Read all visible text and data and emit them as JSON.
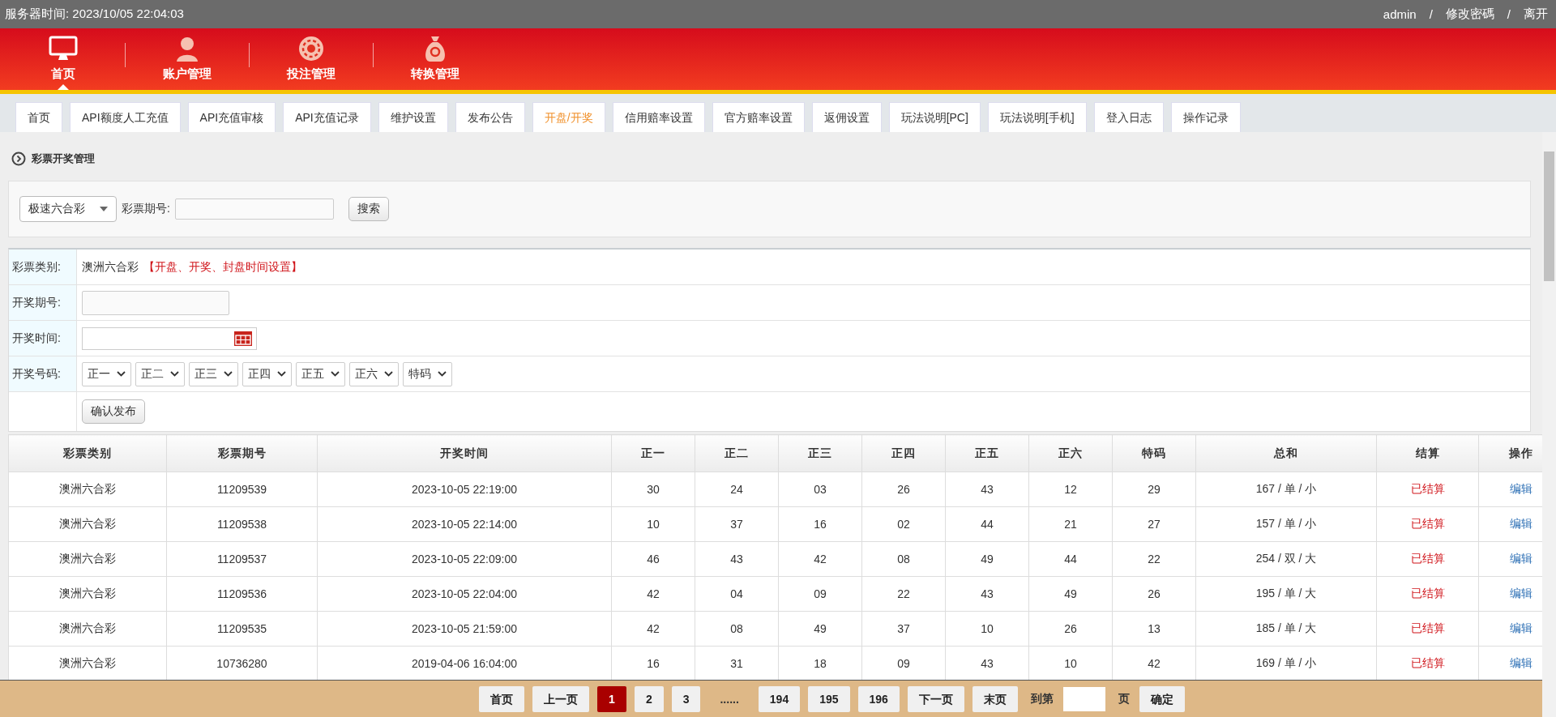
{
  "top_bar": {
    "server_time_label": "服务器时间:",
    "server_time": "2023/10/05 22:04:03",
    "user": "admin",
    "separator": "/",
    "links": [
      "修改密碼",
      "离开"
    ]
  },
  "main_nav": [
    {
      "label": "首页",
      "selected": true
    },
    {
      "label": "账户管理",
      "selected": false
    },
    {
      "label": "投注管理",
      "selected": false
    },
    {
      "label": "转换管理",
      "selected": false
    }
  ],
  "tabs": [
    {
      "label": "首页",
      "selected": false
    },
    {
      "label": "API额度人工充值",
      "selected": false
    },
    {
      "label": "API充值审核",
      "selected": false
    },
    {
      "label": "API充值记录",
      "selected": false
    },
    {
      "label": "维护设置",
      "selected": false
    },
    {
      "label": "发布公告",
      "selected": false
    },
    {
      "label": "开盘/开奖",
      "selected": true
    },
    {
      "label": "信用赔率设置",
      "selected": false
    },
    {
      "label": "官方赔率设置",
      "selected": false
    },
    {
      "label": "返佣设置",
      "selected": false
    },
    {
      "label": "玩法说明[PC]",
      "selected": false
    },
    {
      "label": "玩法说明[手机]",
      "selected": false
    },
    {
      "label": "登入日志",
      "selected": false
    },
    {
      "label": "操作记录",
      "selected": false
    }
  ],
  "section_title": "彩票开奖管理",
  "search": {
    "lottery_select": "极速六合彩",
    "period_label": "彩票期号:",
    "button": "搜索"
  },
  "form": [
    {
      "kind": "text",
      "label": "彩票类别:",
      "value": "澳洲六合彩",
      "link": "【开盘、开奖、封盘时间设置】"
    },
    {
      "kind": "input",
      "label": "开奖期号:"
    },
    {
      "kind": "datetime",
      "label": "开奖时间:"
    },
    {
      "kind": "selects",
      "label": "开奖号码:",
      "options": [
        "正一",
        "正二",
        "正三",
        "正四",
        "正五",
        "正六",
        "特码"
      ]
    },
    {
      "kind": "button",
      "button": "确认发布"
    }
  ],
  "table": {
    "columns": [
      "彩票类别",
      "彩票期号",
      "开奖时间",
      "正一",
      "正二",
      "正三",
      "正四",
      "正五",
      "正六",
      "特码",
      "总和",
      "结算",
      "操作"
    ],
    "rows": [
      [
        "澳洲六合彩",
        "11209539",
        "2023-10-05 22:19:00",
        "30",
        "24",
        "03",
        "26",
        "43",
        "12",
        "29",
        "167 / 单 / 小",
        "已结算",
        "编辑"
      ],
      [
        "澳洲六合彩",
        "11209538",
        "2023-10-05 22:14:00",
        "10",
        "37",
        "16",
        "02",
        "44",
        "21",
        "27",
        "157 / 单 / 小",
        "已结算",
        "编辑"
      ],
      [
        "澳洲六合彩",
        "11209537",
        "2023-10-05 22:09:00",
        "46",
        "43",
        "42",
        "08",
        "49",
        "44",
        "22",
        "254 / 双 / 大",
        "已结算",
        "编辑"
      ],
      [
        "澳洲六合彩",
        "11209536",
        "2023-10-05 22:04:00",
        "42",
        "04",
        "09",
        "22",
        "43",
        "49",
        "26",
        "195 / 单 / 大",
        "已结算",
        "编辑"
      ],
      [
        "澳洲六合彩",
        "11209535",
        "2023-10-05 21:59:00",
        "42",
        "08",
        "49",
        "37",
        "10",
        "26",
        "13",
        "185 / 单 / 大",
        "已结算",
        "编辑"
      ],
      [
        "澳洲六合彩",
        "10736280",
        "2019-04-06 16:04:00",
        "16",
        "31",
        "18",
        "09",
        "43",
        "10",
        "42",
        "169 / 单 / 小",
        "已结算",
        "编辑"
      ]
    ]
  },
  "pagination": {
    "pages": [
      {
        "label": "首页",
        "selected": false
      },
      {
        "label": "上一页",
        "selected": false
      },
      {
        "label": "1",
        "selected": true
      },
      {
        "label": "2",
        "selected": false
      },
      {
        "label": "3",
        "selected": false
      },
      {
        "label": "......",
        "kind": "gap"
      },
      {
        "label": "194",
        "selected": false
      },
      {
        "label": "195",
        "selected": false
      },
      {
        "label": "196",
        "selected": false
      },
      {
        "label": "下一页",
        "selected": false
      },
      {
        "label": "末页",
        "selected": false
      }
    ],
    "goto_label": "到第",
    "page_unit": "页",
    "confirm": "确定"
  }
}
